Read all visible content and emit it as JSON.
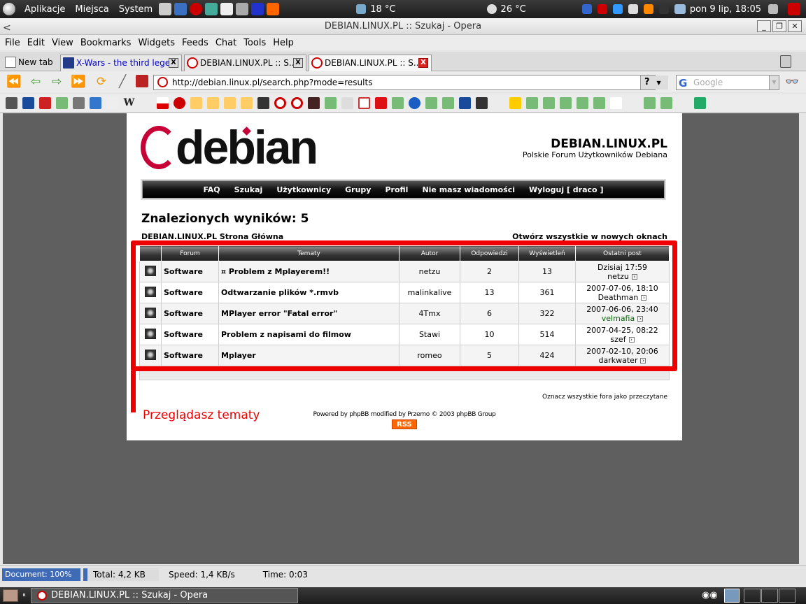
{
  "gnome_panel": {
    "menus": [
      "Aplikacje",
      "Miejsca",
      "System"
    ],
    "weather1": "18 °C",
    "weather2": "26 °C",
    "datetime": "pon  9 lip, 18:05"
  },
  "window": {
    "title": "DEBIAN.LINUX.PL :: Szukaj - Opera"
  },
  "menubar": [
    "File",
    "Edit",
    "View",
    "Bookmarks",
    "Widgets",
    "Feeds",
    "Chat",
    "Tools",
    "Help"
  ],
  "tabs": {
    "new_tab": "New tab",
    "items": [
      {
        "label": "X-Wars - the third lege..."
      },
      {
        "label": "DEBIAN.LINUX.PL :: S..."
      },
      {
        "label": "DEBIAN.LINUX.PL :: S..."
      }
    ],
    "close_glyph": "X"
  },
  "address": {
    "url": "http://debian.linux.pl/search.php?mode=results",
    "help": "?",
    "search_placeholder": "Google"
  },
  "site": {
    "logo_text": "debian",
    "title": "DEBIAN.LINUX.PL",
    "description": "Polskie Forum Użytkowników Debiana",
    "nav": [
      "FAQ",
      "Szukaj",
      "Użytkownicy",
      "Grupy",
      "Profil",
      "Nie masz wiadomości",
      "Wyloguj [ draco ]"
    ]
  },
  "search": {
    "results_title": "Znalezionych wyników: 5",
    "breadcrumb": "DEBIAN.LINUX.PL Strona Główna",
    "open_all": "Otwórz wszystkie w nowych oknach",
    "columns": [
      "Forum",
      "Tematy",
      "Autor",
      "Odpowiedzi",
      "Wyświetleń",
      "Ostatni post"
    ],
    "rows": [
      {
        "forum": "Software",
        "topic": "¤ Problem z Mplayerem!!",
        "author": "netzu",
        "replies": "2",
        "views": "13",
        "last_date": "Dzisiaj 17:59",
        "last_user": "netzu"
      },
      {
        "forum": "Software",
        "topic": "Odtwarzanie plików *.rmvb",
        "author": "malinkalive",
        "replies": "13",
        "views": "361",
        "last_date": "2007-07-06, 18:10",
        "last_user": "Deathman"
      },
      {
        "forum": "Software",
        "topic": "MPlayer error \"Fatal error\"",
        "author": "4Tmx",
        "replies": "6",
        "views": "322",
        "last_date": "2007-06-06, 23:40",
        "last_user": "velmafia"
      },
      {
        "forum": "Software",
        "topic": "Problem z napisami do filmow",
        "author": "Stawi",
        "replies": "10",
        "views": "514",
        "last_date": "2007-04-25, 08:22",
        "last_user": "szef"
      },
      {
        "forum": "Software",
        "topic": "Mplayer",
        "author": "romeo",
        "replies": "5",
        "views": "424",
        "last_date": "2007-02-10, 20:06",
        "last_user": "darkwater"
      }
    ],
    "mark_read": "Oznacz wszystkie fora jako przeczytane",
    "annotation": "Przeglądasz tematy",
    "powered": "Powered by phpBB modified by Przemo © 2003 phpBB Group",
    "rss": "RSS"
  },
  "statusbar": {
    "document": "Document:  100%",
    "total": "Total:  4,2 KB",
    "speed": "Speed:  1,4 KB/s",
    "time": "Time:  0:03"
  },
  "taskbar": {
    "window": "DEBIAN.LINUX.PL :: Szukaj - Opera"
  },
  "colors": {
    "debian_red": "#c70036",
    "annotation_red": "#ee0000",
    "velmafia": "#006600"
  }
}
